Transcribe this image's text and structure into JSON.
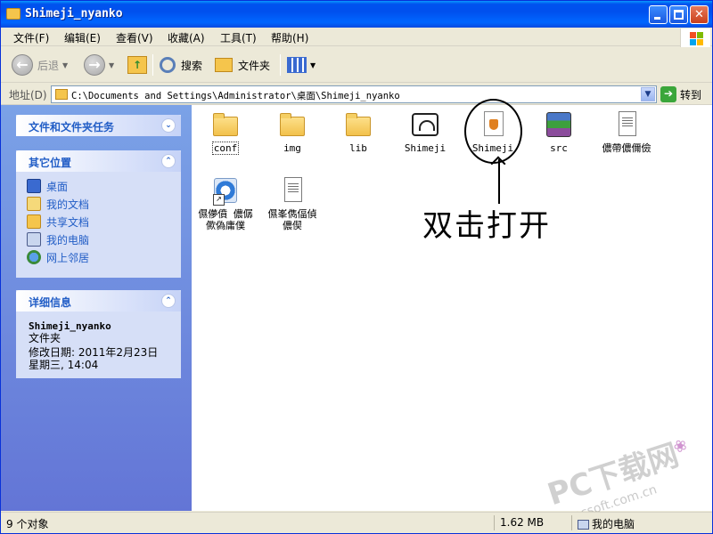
{
  "window": {
    "title": "Shimeji_nyanko"
  },
  "menu": {
    "items": [
      "文件(F)",
      "编辑(E)",
      "查看(V)",
      "收藏(A)",
      "工具(T)",
      "帮助(H)"
    ]
  },
  "toolbar": {
    "back_label": "后退",
    "search_label": "搜索",
    "folders_label": "文件夹"
  },
  "address": {
    "label": "地址(D)",
    "value": "C:\\Documents and Settings\\Administrator\\桌面\\Shimeji_nyanko",
    "go_label": "转到"
  },
  "sidebar": {
    "tasks": {
      "title": "文件和文件夹任务"
    },
    "places": {
      "title": "其它位置",
      "items": [
        "桌面",
        "我的文档",
        "共享文档",
        "我的电脑",
        "网上邻居"
      ]
    },
    "details": {
      "title": "详细信息",
      "name": "Shimeji_nyanko",
      "type": "文件夹",
      "modified_label": "修改日期: 2011年2月23日",
      "modified_time": "星期三, 14:04"
    }
  },
  "files": [
    {
      "name": "conf",
      "kind": "folder"
    },
    {
      "name": "img",
      "kind": "folder"
    },
    {
      "name": "lib",
      "kind": "folder"
    },
    {
      "name": "Shimeji",
      "kind": "exe"
    },
    {
      "name": "Shimeji",
      "kind": "jar"
    },
    {
      "name": "src",
      "kind": "archive"
    },
    {
      "name": "儂帶儂儞儉",
      "kind": "text"
    },
    {
      "name": "儑儚僨 儂僝\n僛偽庸僕",
      "kind": "shortcut"
    },
    {
      "name": "儑峯儁偪偵\n儂偰",
      "kind": "text"
    }
  ],
  "annotation": {
    "text": "双击打开"
  },
  "watermark": {
    "text": "PC下载网",
    "site": "pcsoft.com.cn"
  },
  "status": {
    "objects": "9 个对象",
    "size": "1.62 MB",
    "location": "我的电脑"
  }
}
